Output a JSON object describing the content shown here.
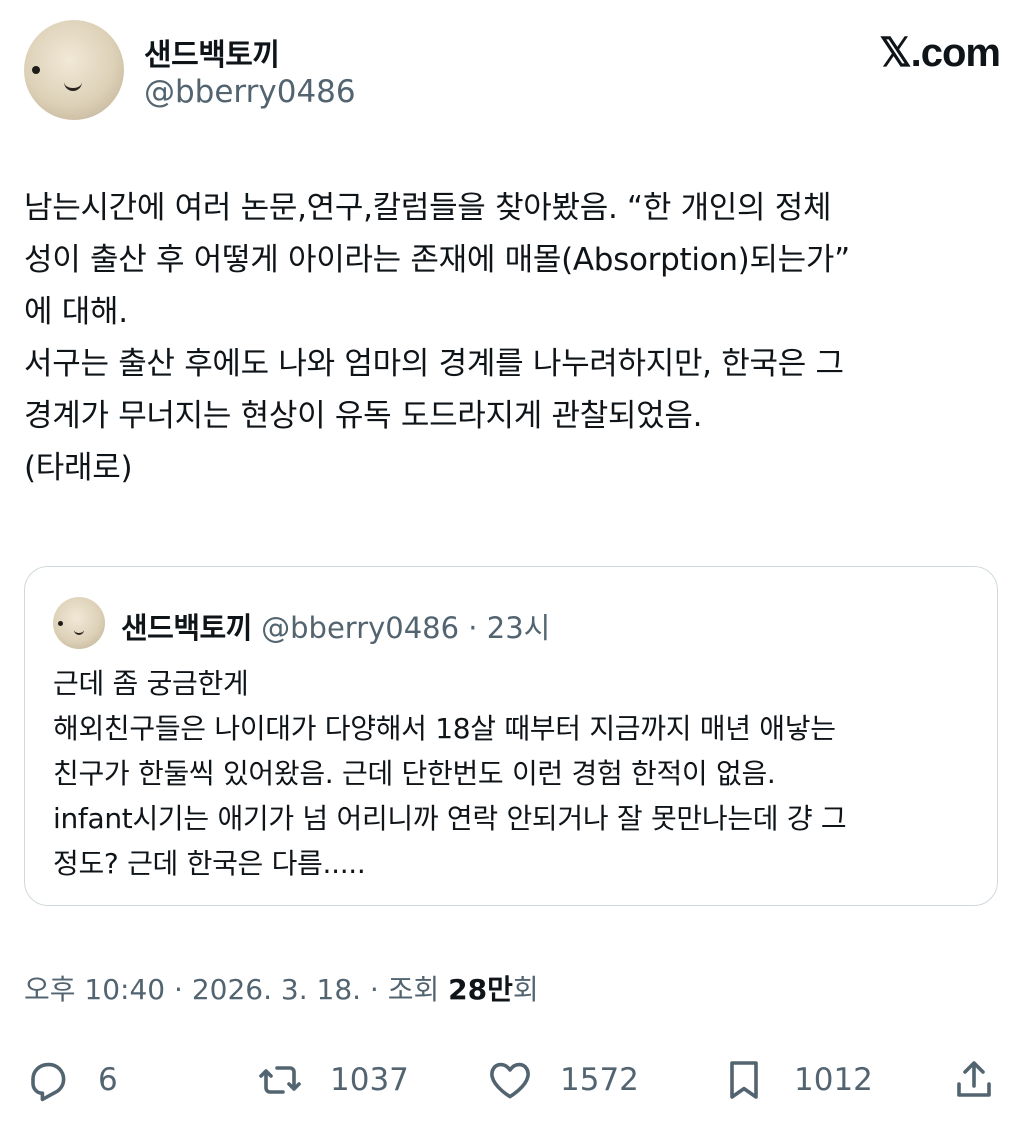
{
  "author": {
    "name": "샌드백토끼",
    "handle": "@bberry0486"
  },
  "brand": "𝕏.com",
  "tweet": {
    "lines": [
      "남는시간에 여러 논문,연구,칼럼들을 찾아봤음. “한 개인의 정체",
      "성이 출산 후 어떻게 아이라는 존재에 매몰(Absorption)되는가”",
      "에 대해.",
      "서구는 출산 후에도 나와 엄마의 경계를 나누려하지만, 한국은 그",
      "경계가 무너지는 현상이 유독 도드라지게 관찰되었음.",
      "(타래로)"
    ]
  },
  "quote": {
    "name": "샌드백토끼",
    "handle": "@bberry0486",
    "separator": " · ",
    "time": "23시",
    "lines": [
      "근데 좀 궁금한게",
      "해외친구들은 나이대가 다양해서 18살 때부터 지금까지 매년 애낳는",
      "친구가 한둘씩 있어왔음. 근데 단한번도 이런 경험 한적이 없음.",
      "infant시기는 애기가 넘 어리니까 연락 안되거나 잘 못만나는데 걍 그",
      "정도? 근데 한국은 다름....."
    ]
  },
  "meta": {
    "time": "오후 10:40",
    "date": "2026. 3. 18.",
    "views_prefix": "조회",
    "views_num": "28만",
    "views_suffix": "회",
    "sep": " · "
  },
  "actions": {
    "replies": "6",
    "reposts": "1037",
    "likes": "1572",
    "bookmarks": "1012"
  },
  "icons": [
    "reply-icon",
    "repost-icon",
    "like-icon",
    "bookmark-icon",
    "share-icon"
  ],
  "colors": {
    "text": "#0f1419",
    "secondary": "#536471",
    "border": "#cfd9de"
  }
}
